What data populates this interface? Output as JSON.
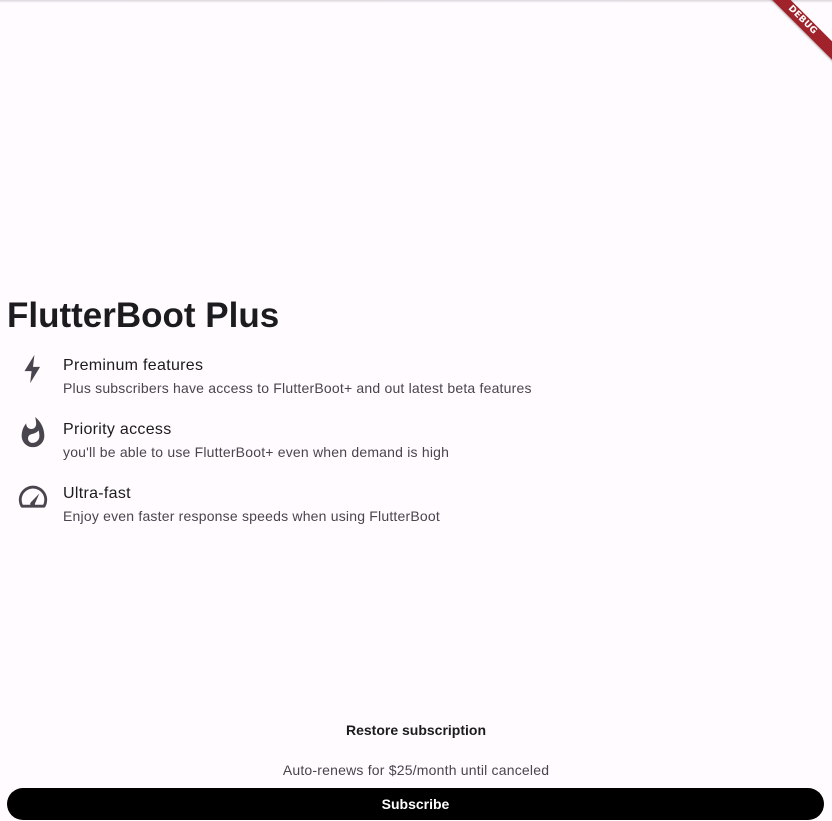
{
  "debug_banner": "DEBUG",
  "title": "FlutterBoot Plus",
  "features": [
    {
      "icon": "bolt-icon",
      "title": "Preminum features",
      "description": "Plus subscribers have access to FlutterBoot+ and out latest beta features"
    },
    {
      "icon": "flame-icon",
      "title": "Priority access",
      "description": "you'll be able to use FlutterBoot+ even when demand is high"
    },
    {
      "icon": "speedometer-icon",
      "title": "Ultra-fast",
      "description": "Enjoy even faster response speeds when using FlutterBoot"
    }
  ],
  "restore_label": "Restore subscription",
  "renew_text": "Auto-renews for $25/month until canceled",
  "subscribe_label": "Subscribe",
  "colors": {
    "background": "#fffbfe",
    "button": "#000000",
    "button_text": "#ffffff",
    "debug_banner": "#a0232b"
  }
}
